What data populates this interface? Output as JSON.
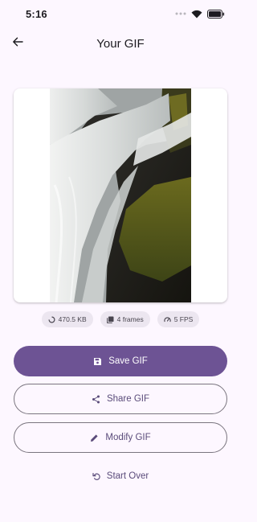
{
  "status_bar": {
    "time": "5:16",
    "icons": [
      "signal-dots-icon",
      "wifi-icon",
      "battery-icon"
    ]
  },
  "app_bar": {
    "back_icon": "arrow-left-icon",
    "title": "Your GIF"
  },
  "preview": {
    "icon": "gif-preview-image"
  },
  "info_chips": [
    {
      "icon": "progress-circle-icon",
      "label": "470.5 KB"
    },
    {
      "icon": "frames-icon",
      "label": "4 frames"
    },
    {
      "icon": "speed-icon",
      "label": "5 FPS"
    }
  ],
  "actions": {
    "save": {
      "icon": "save-icon",
      "label": "Save GIF"
    },
    "share": {
      "icon": "share-icon",
      "label": "Share GIF"
    },
    "modify": {
      "icon": "edit-icon",
      "label": "Modify GIF"
    },
    "start_over": {
      "icon": "restart-icon",
      "label": "Start Over"
    }
  },
  "colors": {
    "background": "#fdf7ff",
    "primary": "#6d5394",
    "outline": "#7a757f",
    "chip": "#ece6f0"
  }
}
